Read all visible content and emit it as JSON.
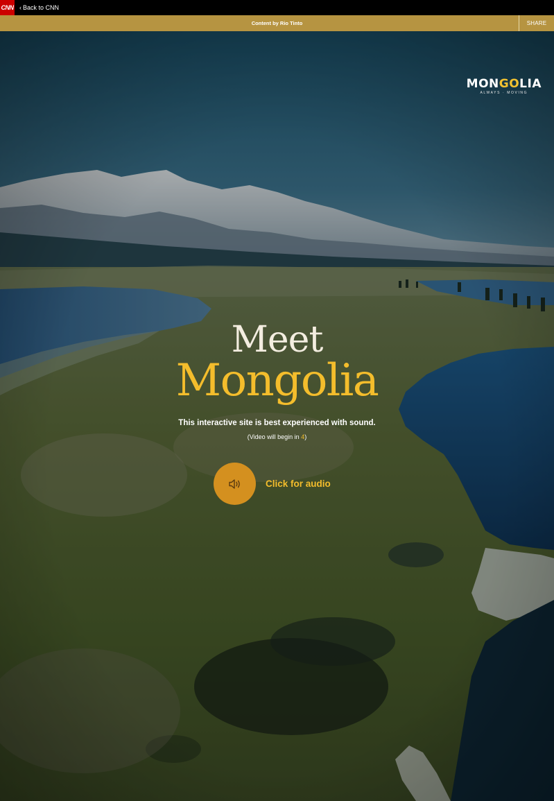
{
  "topbar": {
    "cnn_logo": "CNN",
    "back_chevron": "‹",
    "back_label": "Back to CNN"
  },
  "sponsor": {
    "label": "Content by Rio Tinto",
    "share_label": "SHARE"
  },
  "brand": {
    "word_part1": "MON",
    "word_part2": "GO",
    "word_part3": "LIA",
    "tagline": "ALWAYS · MOVING"
  },
  "intro": {
    "line1": "Meet",
    "line2": "Mongolia",
    "sound_note": "This interactive site is best experienced with sound.",
    "countdown_prefix": "(Video will begin in ",
    "countdown_value": "4",
    "countdown_suffix": ")"
  },
  "audio": {
    "label": "Click for audio",
    "icon": "speaker-icon"
  },
  "colors": {
    "cnn_red": "#cc0000",
    "sponsor_gold": "#b69441",
    "accent_yellow": "#f4bd2c",
    "audio_button": "#d4901f"
  }
}
